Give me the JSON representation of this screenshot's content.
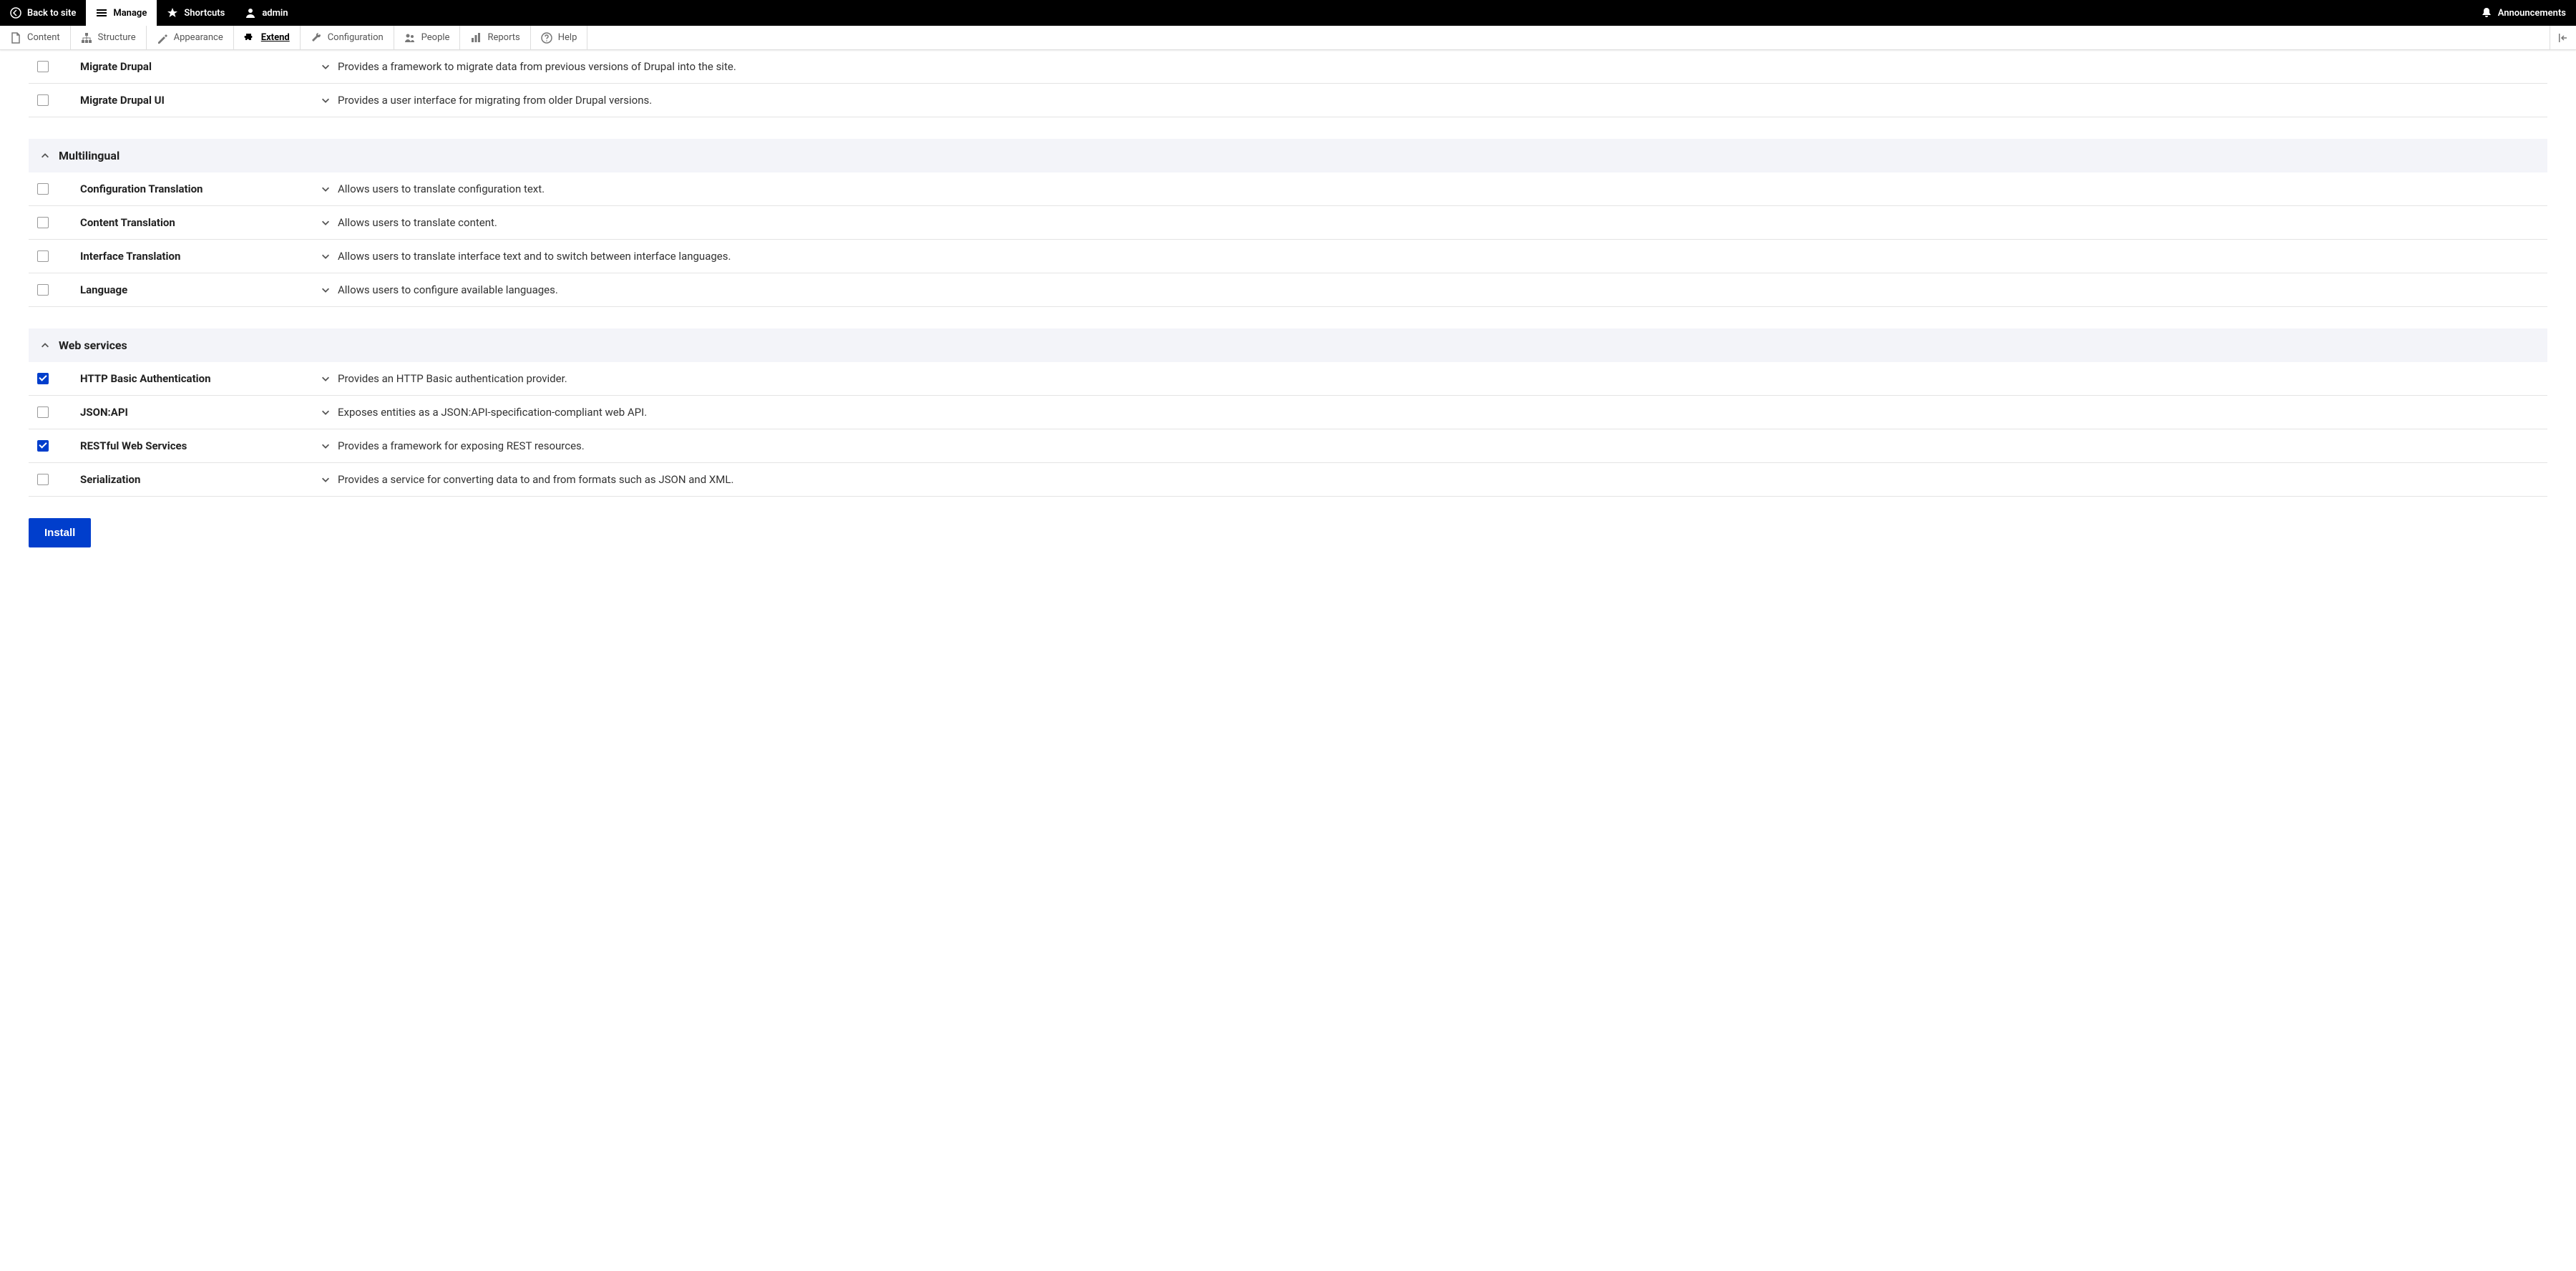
{
  "toolbar": {
    "back": "Back to site",
    "manage": "Manage",
    "shortcuts": "Shortcuts",
    "admin": "admin",
    "announcements": "Announcements"
  },
  "admin_menu": {
    "items": [
      {
        "label": "Content",
        "icon": "file"
      },
      {
        "label": "Structure",
        "icon": "structure"
      },
      {
        "label": "Appearance",
        "icon": "appearance"
      },
      {
        "label": "Extend",
        "icon": "puzzle",
        "active": true
      },
      {
        "label": "Configuration",
        "icon": "wrench"
      },
      {
        "label": "People",
        "icon": "people"
      },
      {
        "label": "Reports",
        "icon": "reports"
      },
      {
        "label": "Help",
        "icon": "help"
      }
    ]
  },
  "groups": [
    {
      "title": null,
      "modules": [
        {
          "name": "Migrate Drupal",
          "desc": "Provides a framework to migrate data from previous versions of Drupal into the site.",
          "checked": false
        },
        {
          "name": "Migrate Drupal UI",
          "desc": "Provides a user interface for migrating from older Drupal versions.",
          "checked": false
        }
      ]
    },
    {
      "title": "Multilingual",
      "modules": [
        {
          "name": "Configuration Translation",
          "desc": "Allows users to translate configuration text.",
          "checked": false
        },
        {
          "name": "Content Translation",
          "desc": "Allows users to translate content.",
          "checked": false
        },
        {
          "name": "Interface Translation",
          "desc": "Allows users to translate interface text and to switch between interface languages.",
          "checked": false
        },
        {
          "name": "Language",
          "desc": "Allows users to configure available languages.",
          "checked": false
        }
      ]
    },
    {
      "title": "Web services",
      "modules": [
        {
          "name": "HTTP Basic Authentication",
          "desc": "Provides an HTTP Basic authentication provider.",
          "checked": true
        },
        {
          "name": "JSON:API",
          "desc": "Exposes entities as a JSON:API-specification-compliant web API.",
          "checked": false
        },
        {
          "name": "RESTful Web Services",
          "desc": "Provides a framework for exposing REST resources.",
          "checked": true
        },
        {
          "name": "Serialization",
          "desc": "Provides a service for converting data to and from formats such as JSON and XML.",
          "checked": false
        }
      ]
    }
  ],
  "actions": {
    "install": "Install"
  }
}
